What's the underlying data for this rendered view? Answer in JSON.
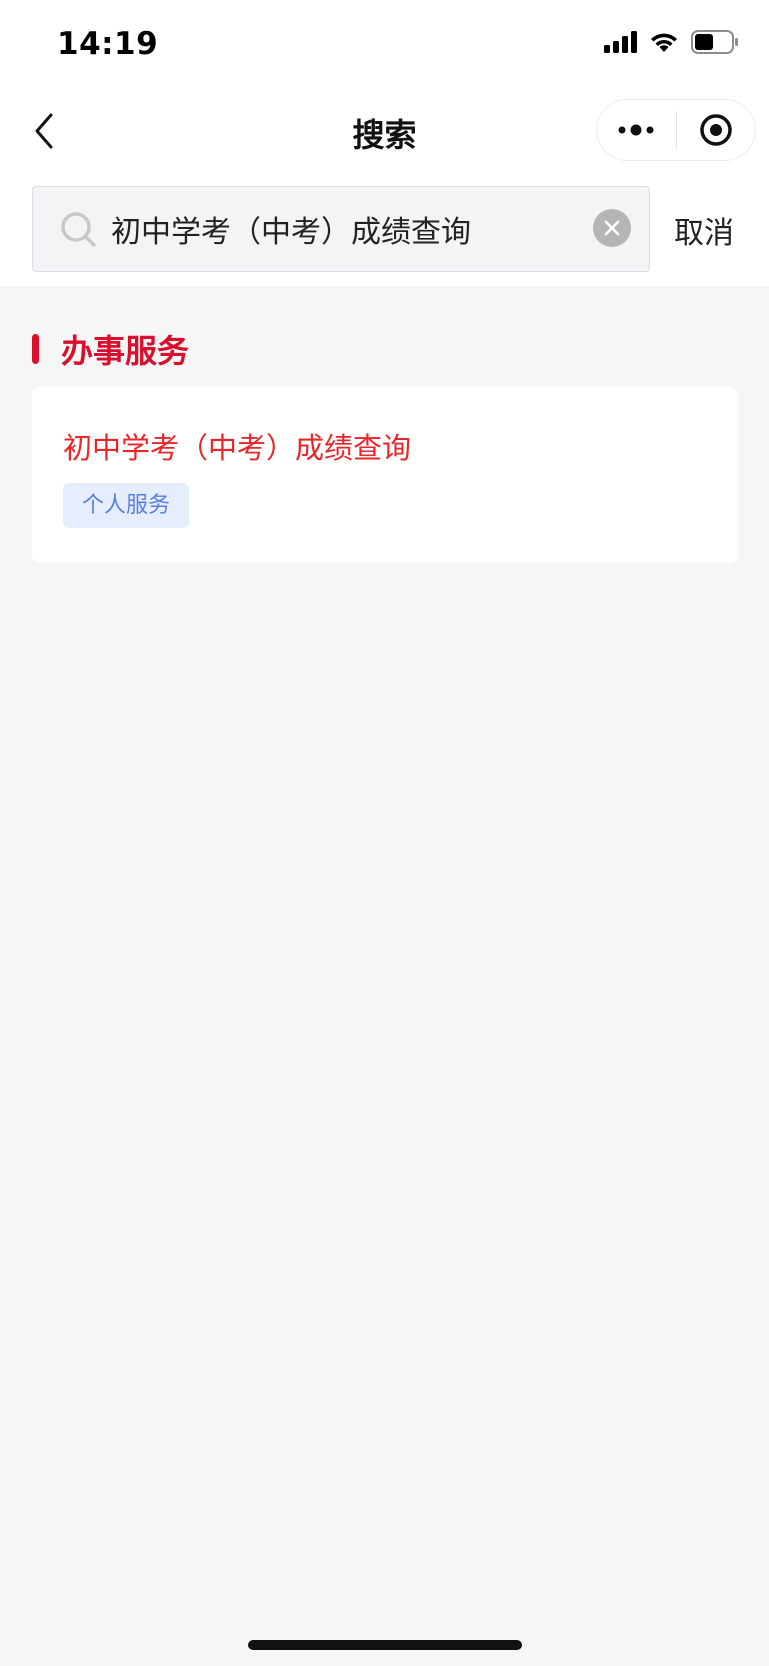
{
  "status_bar": {
    "time": "14:19"
  },
  "nav": {
    "title": "搜索",
    "icons": {
      "back": "chevron-left-icon",
      "more": "more-dots-icon",
      "target": "target-icon"
    }
  },
  "search": {
    "value": "初中学考（中考）成绩查询",
    "placeholder": "",
    "cancel_label": "取消"
  },
  "section": {
    "title": "办事服务"
  },
  "results": [
    {
      "title": "初中学考（中考）成绩查询",
      "tag": "个人服务"
    }
  ],
  "colors": {
    "accent_red": "#d8102c",
    "title_red": "#e8262a",
    "tag_blue": "#5a7fe0",
    "tag_bg": "#e6eefe",
    "background": "#f5f6f8"
  }
}
